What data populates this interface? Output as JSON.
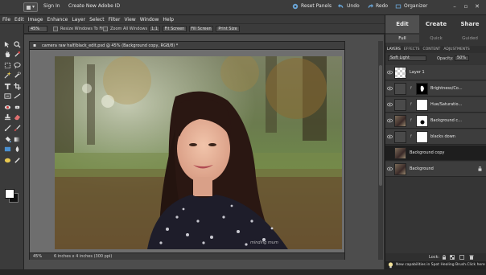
{
  "titlebar": {
    "sign_in": "Sign In",
    "create_id": "Create New Adobe ID",
    "reset_panels": "Reset Panels",
    "undo": "Undo",
    "redo": "Redo",
    "organizer": "Organizer"
  },
  "menu": [
    "File",
    "Edit",
    "Image",
    "Enhance",
    "Layer",
    "Select",
    "Filter",
    "View",
    "Window",
    "Help"
  ],
  "options": {
    "zoom_value": "45%",
    "resize_windows": "Resize Windows To Fit",
    "zoom_all_windows": "Zoom All Windows",
    "one_to_one": "1:1",
    "fit_screen": "Fit Screen",
    "fill_screen": "Fill Screen",
    "print_size": "Print Size"
  },
  "document": {
    "title": "camera raw half/black_edit.psd @ 45% (Background copy, RGB/8) *",
    "status_zoom": "45%",
    "status_size": "6 inches x 4 inches (300 ppi)",
    "watermark": "minding mum"
  },
  "panel": {
    "mode_tabs": [
      "Edit",
      "Create",
      "Share"
    ],
    "sub_tabs": [
      "Full",
      "Quick",
      "Guided"
    ],
    "panel_tabs": [
      "LAYERS",
      "EFFECTS",
      "CONTENT",
      "ADJUSTMENTS"
    ],
    "blend_mode": "Soft Light",
    "opacity_label": "Opacity:",
    "opacity_value": "50%",
    "lock_label": "Lock:"
  },
  "layers": [
    {
      "name": "Layer 1",
      "thumb": "checker",
      "mask": false,
      "selected": false,
      "locked": false
    },
    {
      "name": "Brightness/Co...",
      "thumb": "adjust",
      "mask": "blackmask",
      "selected": false,
      "locked": false
    },
    {
      "name": "Hue/Saturatio...",
      "thumb": "adjust",
      "mask": "white",
      "selected": false,
      "locked": false
    },
    {
      "name": "Background c...",
      "thumb": "photo",
      "mask": "whitemask",
      "selected": false,
      "locked": false
    },
    {
      "name": "blacks down",
      "thumb": "adjust",
      "mask": "white",
      "selected": false,
      "locked": false
    },
    {
      "name": "Background copy",
      "thumb": "photo",
      "mask": false,
      "selected": true,
      "locked": false
    },
    {
      "name": "Background",
      "thumb": "photo",
      "mask": false,
      "selected": false,
      "locked": true
    }
  ],
  "notification": "New capabilities in Spot Healing Brush.Click here",
  "colors": {
    "foreground": "#ffffff",
    "background": "#111111",
    "accent": "#6aa6d8"
  }
}
